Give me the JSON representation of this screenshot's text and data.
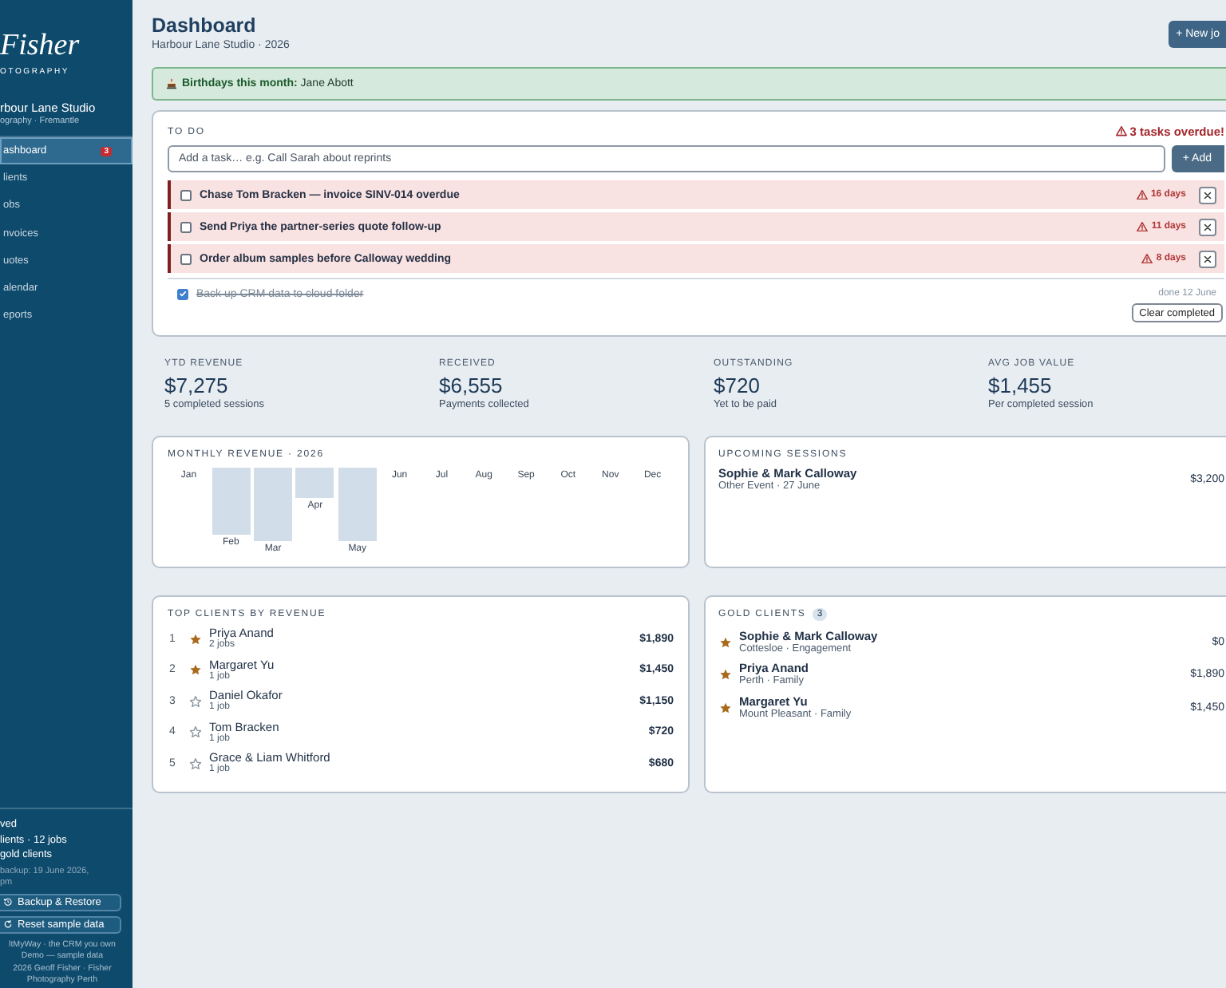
{
  "sidebar": {
    "logo": {
      "wordmark": "Fisher",
      "tagline": "OTOGRAPHY"
    },
    "studio": {
      "name": "rbour Lane Studio",
      "subtitle": "ography · Fremantle"
    },
    "nav": [
      {
        "label": "ashboard",
        "selected": true,
        "badge": "3"
      },
      {
        "label": "lients",
        "selected": false
      },
      {
        "label": "obs",
        "selected": false
      },
      {
        "label": "nvoices",
        "selected": false
      },
      {
        "label": "uotes",
        "selected": false
      },
      {
        "label": "alendar",
        "selected": false
      },
      {
        "label": "eports",
        "selected": false
      }
    ],
    "status": [
      "ved",
      "lients · 12 jobs",
      "gold clients"
    ],
    "backup_note": [
      "backup: 19 June 2026,",
      "pm"
    ],
    "buttons": [
      {
        "label": "Backup & Restore",
        "kind": "backup"
      },
      {
        "label": "Reset sample data",
        "kind": "reset"
      }
    ],
    "footer": [
      "ltMyWay · the CRM you own",
      "Demo — sample data",
      "2026 Geoff Fisher · Fisher",
      "Photography Perth"
    ]
  },
  "header": {
    "title": "Dashboard",
    "subtitle": "Harbour Lane Studio · 2026",
    "action": "+ New jo"
  },
  "banner": {
    "text": "**Birthdays this month:** Jane Abott"
  },
  "todo": {
    "title": "TO DO",
    "alert": "3 tasks overdue!",
    "input": {
      "placeholder": "Add a task… e.g. Call Sarah about reprints"
    },
    "add_button": "+ Add",
    "tasks": [
      {
        "text": "Chase Tom Bracken — invoice SINV-014 overdue",
        "checked": false,
        "overdue": true,
        "due": "16 days"
      },
      {
        "text": "Send Priya the partner-series quote follow-up",
        "checked": false,
        "overdue": true,
        "due": "11 days"
      },
      {
        "text": "Order album samples before Calloway wedding",
        "checked": false,
        "overdue": true,
        "due": "8 days"
      },
      {
        "text": "Back up CRM data to cloud folder",
        "checked": true,
        "overdue": false,
        "due": "done 12 June"
      }
    ],
    "clear_button": "Clear completed"
  },
  "stats": [
    {
      "label": "YTD REVENUE",
      "value": "$7,275",
      "note": "5 completed sessions"
    },
    {
      "label": "RECEIVED",
      "value": "$6,555",
      "note": "Payments collected"
    },
    {
      "label": "OUTSTANDING",
      "value": "$720",
      "note": "Yet to be paid"
    },
    {
      "label": "AVG JOB VALUE",
      "value": "$1,455",
      "note": "Per completed session"
    }
  ],
  "revenue_chart": {
    "title": "MONTHLY REVENUE · 2026",
    "months": [
      "Jan",
      "Feb",
      "Mar",
      "Apr",
      "May",
      "Jun",
      "Jul",
      "Aug",
      "Sep",
      "Oct",
      "Nov",
      "Dec"
    ]
  },
  "upcoming": {
    "title": "UPCOMING SESSIONS",
    "sessions": [
      {
        "name": "Sophie & Mark Calloway",
        "detail": "Other Event · 27 June",
        "amount": "$3,200"
      }
    ]
  },
  "top_clients": {
    "title": "TOP CLIENTS BY REVENUE",
    "clients": [
      {
        "rank": "1",
        "starred": true,
        "name": "Priya Anand",
        "jobs": "2 jobs",
        "amount": "$1,890"
      },
      {
        "rank": "2",
        "starred": true,
        "name": "Margaret Yu",
        "jobs": "1 job",
        "amount": "$1,450"
      },
      {
        "rank": "3",
        "starred": false,
        "name": "Daniel Okafor",
        "jobs": "1 job",
        "amount": "$1,150"
      },
      {
        "rank": "4",
        "starred": false,
        "name": "Tom Bracken",
        "jobs": "1 job",
        "amount": "$720"
      },
      {
        "rank": "5",
        "starred": false,
        "name": "Grace & Liam Whitford",
        "jobs": "1 job",
        "amount": "$680"
      }
    ]
  },
  "gold_clients": {
    "title": "GOLD CLIENTS",
    "count": "3",
    "clients": [
      {
        "name": "Sophie & Mark Calloway",
        "detail": "Cottesloe · Engagement",
        "amount": "$0"
      },
      {
        "name": "Priya Anand",
        "detail": "Perth · Family",
        "amount": "$1,890"
      },
      {
        "name": "Margaret Yu",
        "detail": "Mount Pleasant · Family",
        "amount": "$1,450"
      }
    ]
  }
}
